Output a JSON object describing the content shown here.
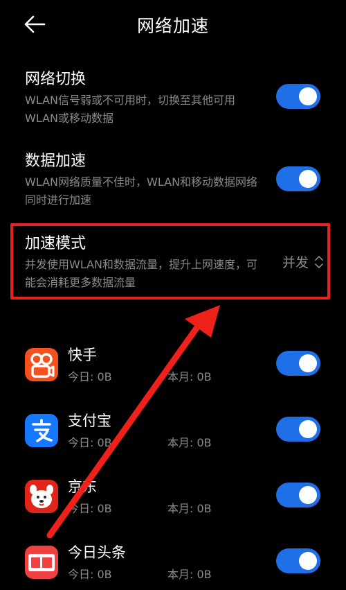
{
  "header": {
    "title": "网络加速"
  },
  "settings": {
    "network_switch": {
      "title": "网络切换",
      "desc": "WLAN信号弱或不可用时，切换至其他可用WLAN或移动数据",
      "enabled": true
    },
    "data_acceleration": {
      "title": "数据加速",
      "desc": "WLAN网络质量不佳时，WLAN和移动数据网络同时进行加速",
      "enabled": true
    },
    "acceleration_mode": {
      "title": "加速模式",
      "desc": "并发使用WLAN和数据流量，提升上网速度，可能会消耗更多数据流量",
      "value": "并发"
    }
  },
  "apps": [
    {
      "name": "快手",
      "today": "今日: 0B",
      "month": "本月: 0B",
      "enabled": true,
      "icon": "kuaishou-icon",
      "color": "#f4511e"
    },
    {
      "name": "支付宝",
      "today": "今日: 0B",
      "month": "本月: 0B",
      "enabled": true,
      "icon": "alipay-icon",
      "color": "#1677ff"
    },
    {
      "name": "京东",
      "today": "今日: 0B",
      "month": "本月: 0B",
      "enabled": true,
      "icon": "jd-icon",
      "color": "#e1251b"
    },
    {
      "name": "今日头条",
      "today": "今日: 0B",
      "month": "本月: 0B",
      "enabled": true,
      "icon": "toutiao-icon",
      "color": "#f04142"
    }
  ],
  "colors": {
    "toggle_on": "#1f6fe6",
    "highlight_border": "#e8221c",
    "secondary_text": "#8a8a8a"
  }
}
